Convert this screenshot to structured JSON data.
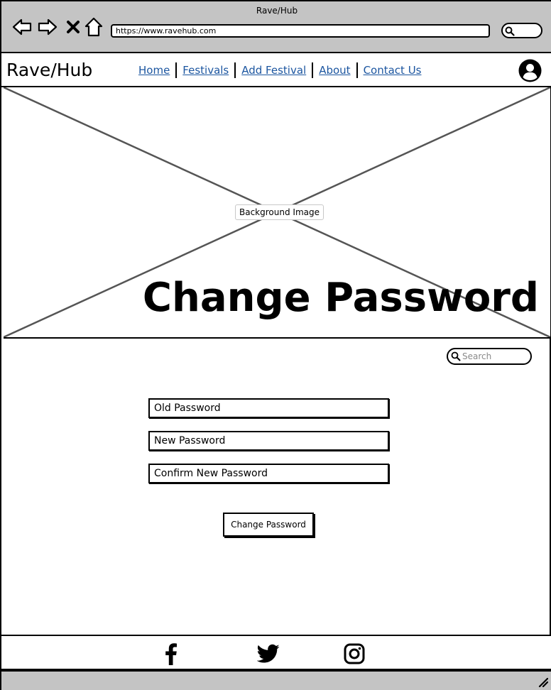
{
  "browser": {
    "window_title": "Rave/Hub",
    "url": "https://www.ravehub.com",
    "icons": [
      "back-icon",
      "forward-icon",
      "close-icon",
      "home-icon",
      "search-icon"
    ]
  },
  "header": {
    "logo": "Rave/Hub",
    "nav": [
      {
        "label": "Home"
      },
      {
        "label": "Festivals"
      },
      {
        "label": "Add Festival"
      },
      {
        "label": "About"
      },
      {
        "label": "Contact Us"
      }
    ],
    "avatar_icon": "user-icon"
  },
  "hero": {
    "image_label": "Background Image",
    "title": "Change Password"
  },
  "content": {
    "search_placeholder": "Search",
    "fields": {
      "old_password": "Old Password",
      "new_password": "New Password",
      "confirm_password": "Confirm New Password"
    },
    "submit_label": "Change Password"
  },
  "footer": {
    "social": [
      "facebook-icon",
      "twitter-icon",
      "instagram-icon"
    ]
  },
  "colors": {
    "chrome": "#c4c4c4",
    "link": "#1c56a0",
    "border": "#000000"
  }
}
